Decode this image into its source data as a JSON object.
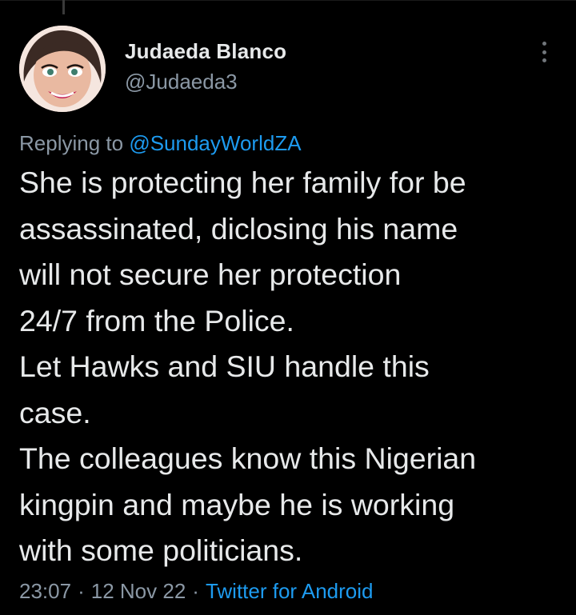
{
  "tweet": {
    "author": {
      "display_name": "Judaeda Blanco",
      "handle": "@Judaeda3"
    },
    "replying_to": {
      "prefix": "Replying to",
      "mention": "@SundayWorldZA"
    },
    "text_lines": [
      "She is protecting her family for be",
      "assassinated, diclosing his name",
      "will not secure her protection",
      "24/7 from the Police.",
      "Let Hawks and SIU handle this",
      "case.",
      "The colleagues know this Nigerian",
      "kingpin and maybe he is working",
      "with some politicians."
    ],
    "meta": {
      "time": "23:07",
      "separator": "·",
      "date": "12 Nov 22",
      "source": "Twitter for Android"
    }
  },
  "icons": {
    "more": "more-options-icon"
  },
  "colors": {
    "background": "#000000",
    "primary_text": "#e7e9ea",
    "secondary_text": "#8b98a5",
    "link": "#1d9bf0"
  }
}
